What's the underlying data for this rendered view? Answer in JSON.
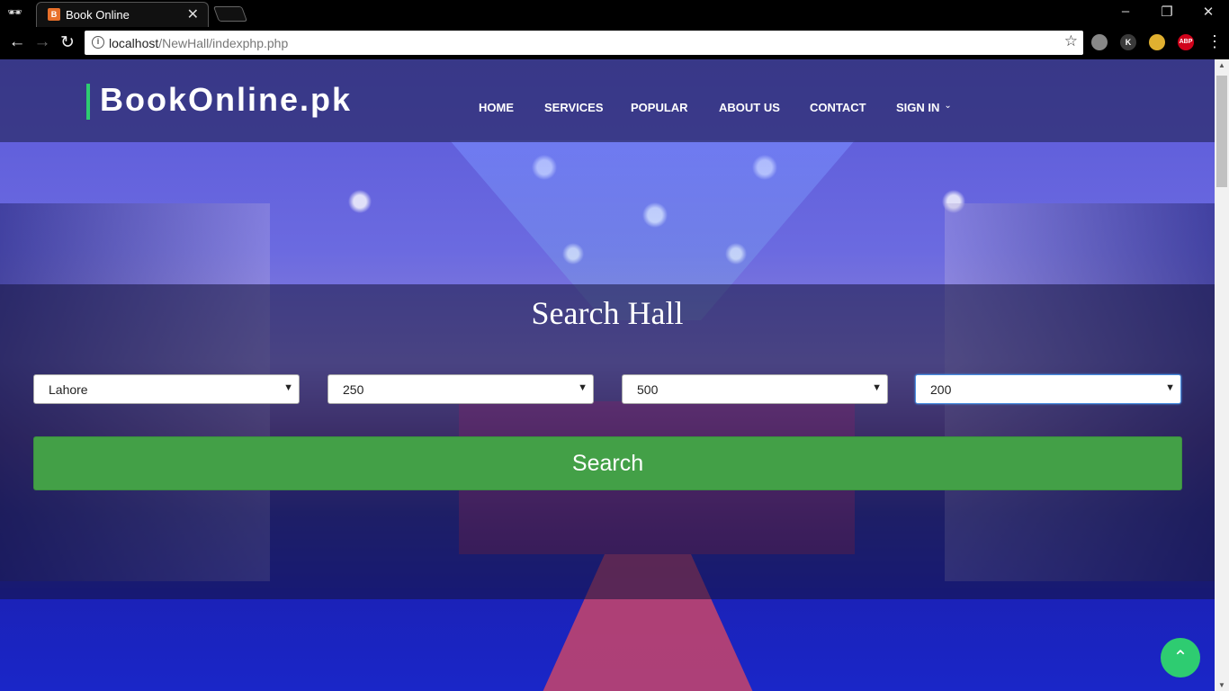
{
  "browser": {
    "tab_title": "Book Online",
    "tab_favicon_letter": "B",
    "url_host": "localhost",
    "url_path": "/NewHall/indexphp.php",
    "extensions": [
      {
        "name": "globe-icon",
        "label": "",
        "color": "#888888"
      },
      {
        "name": "k-extension-icon",
        "label": "K",
        "color": "#3a3a3a"
      },
      {
        "name": "pinwheel-extension-icon",
        "label": "",
        "color": "#e0b030"
      },
      {
        "name": "adblock-plus-icon",
        "label": "ABP",
        "color": "#d0021b"
      }
    ]
  },
  "header": {
    "logo": "BookOnline.pk",
    "nav": [
      {
        "label": "HOME"
      },
      {
        "label": "SERVICES"
      },
      {
        "label": "POPULAR"
      },
      {
        "label": "ABOUT US"
      },
      {
        "label": "CONTACT"
      },
      {
        "label": "SIGN IN"
      }
    ]
  },
  "search": {
    "title": "Search Hall",
    "selects": [
      {
        "value": "Lahore"
      },
      {
        "value": "250"
      },
      {
        "value": "500"
      },
      {
        "value": "200"
      }
    ],
    "button_label": "Search"
  },
  "colors": {
    "accent_green": "#43a047",
    "logo_bar": "#2ecc71",
    "header_bg": "#2d2d6e"
  }
}
